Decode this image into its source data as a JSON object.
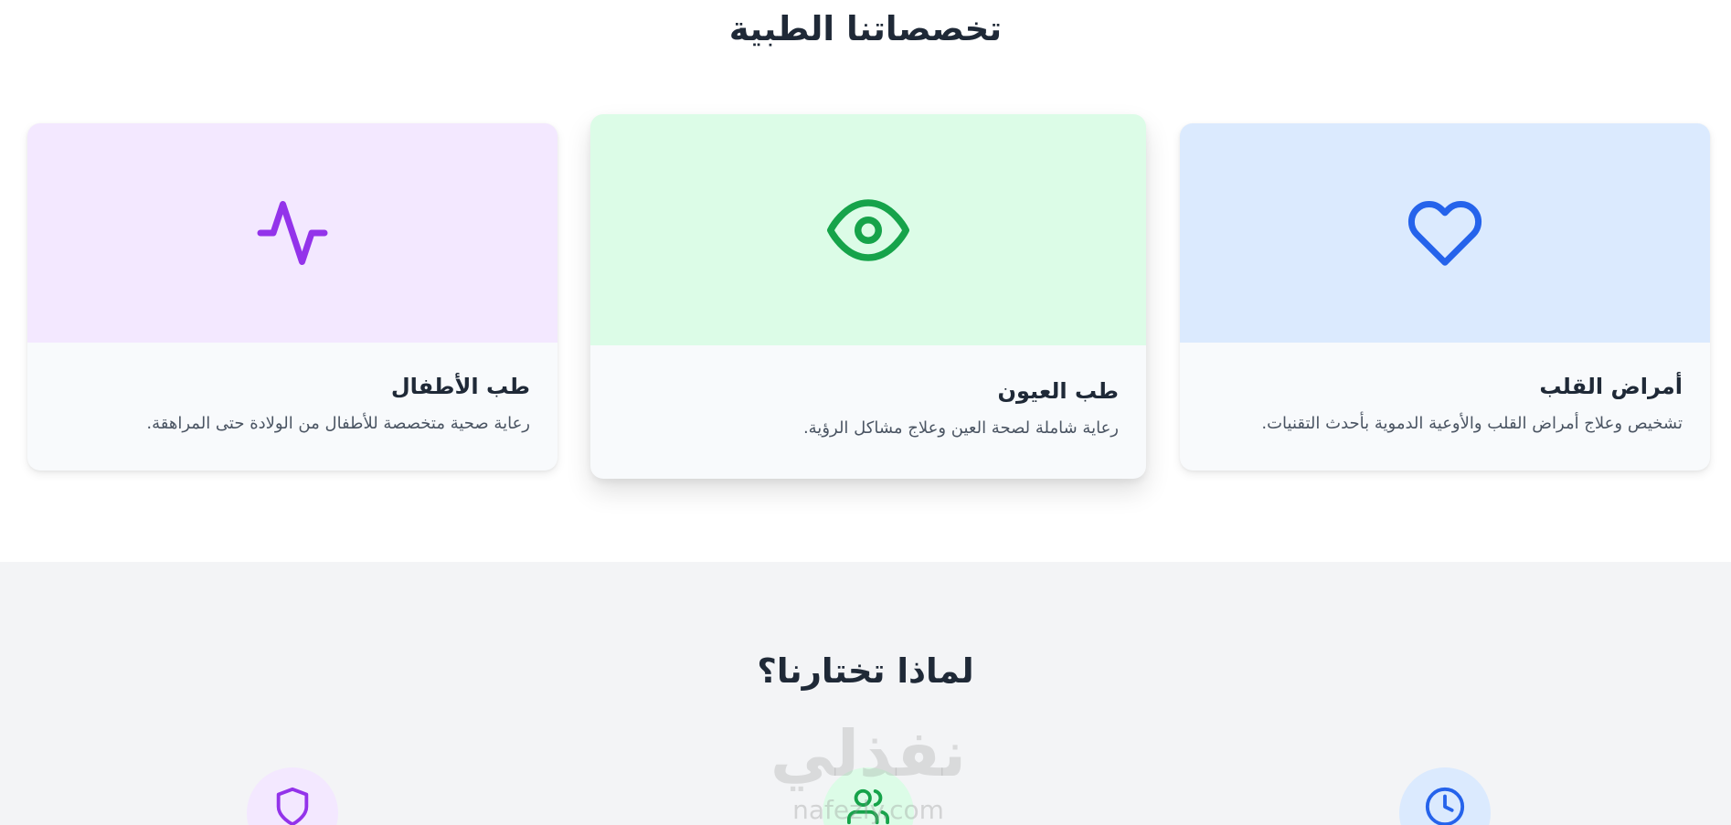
{
  "specialties": {
    "title": "تخصصاتنا الطبية",
    "cards": [
      {
        "title": "أمراض القلب",
        "description": "تشخيص وعلاج أمراض القلب والأوعية الدموية بأحدث التقنيات.",
        "icon": "heart-icon",
        "bg_color": "#dbeafe",
        "icon_color": "#2563eb"
      },
      {
        "title": "طب العيون",
        "description": "رعاية شاملة لصحة العين وعلاج مشاكل الرؤية.",
        "icon": "eye-icon",
        "bg_color": "#dcfce7",
        "icon_color": "#16a34a"
      },
      {
        "title": "طب الأطفال",
        "description": "رعاية صحية متخصصة للأطفال من الولادة حتى المراهقة.",
        "icon": "activity-icon",
        "bg_color": "#f3e8ff",
        "icon_color": "#9333ea"
      }
    ]
  },
  "why_us": {
    "title": "لماذا تختارنا؟",
    "features": [
      {
        "icon": "clock-icon",
        "bg_color": "#dbeafe",
        "icon_color": "#2563eb"
      },
      {
        "icon": "users-icon",
        "bg_color": "#dcfce7",
        "icon_color": "#16a34a"
      },
      {
        "icon": "shield-icon",
        "bg_color": "#f3e8ff",
        "icon_color": "#9333ea"
      }
    ]
  },
  "watermark": {
    "arabic": "نفذلي",
    "latin": "nafezly.com"
  }
}
